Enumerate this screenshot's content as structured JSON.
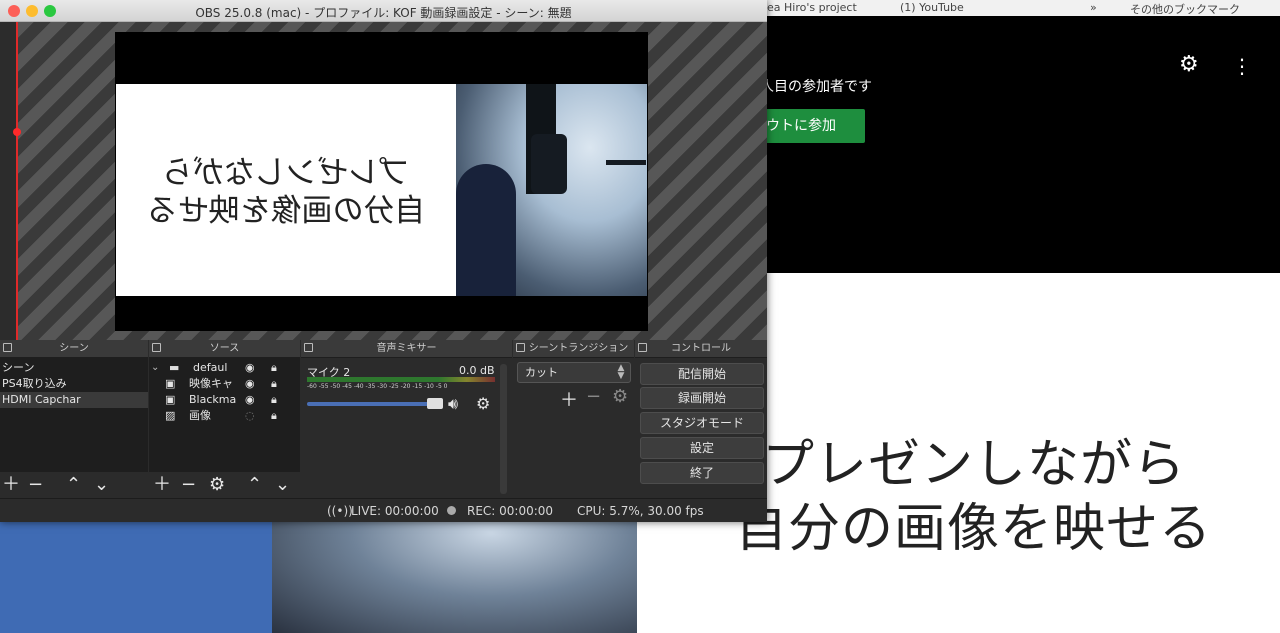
{
  "background": {
    "browser_tabs": [
      "Sea Hiro's project",
      "(1) YouTube",
      "»",
      "その他のブックマーク"
    ],
    "meet_join_text": "人目の参加者です",
    "meet_join_button": "ウトに参加",
    "slide_line1": "プレゼンしながら",
    "slide_line2": "自分の画像を映せる"
  },
  "window": {
    "title": "OBS 25.0.8 (mac) - プロファイル: KOF 動画録画設定 - シーン: 無題"
  },
  "preview": {
    "mirrored_line1": "プレゼンしながら",
    "mirrored_line2": "自分の画像を映せる"
  },
  "docks": {
    "scenes": {
      "title": "シーン",
      "items": [
        "シーン",
        "PS4取り込み",
        "HDMI Capchar"
      ],
      "selected_index": 2
    },
    "sources": {
      "title": "ソース",
      "items": [
        {
          "label": "defaul",
          "icon": "folder-icon"
        },
        {
          "label": "映像キャ",
          "icon": "camera-icon"
        },
        {
          "label": "Blackma",
          "icon": "camera-icon"
        },
        {
          "label": "画像",
          "icon": "image-icon"
        }
      ]
    },
    "mixer": {
      "title": "音声ミキサー",
      "channel": "マイク 2",
      "level": "0.0 dB",
      "ticks": "-60 -55 -50 -45 -40 -35 -30 -25 -20 -15 -10 -5 0",
      "volume_fraction": 0.88
    },
    "transitions": {
      "title": "シーントランジション",
      "selected": "カット"
    },
    "controls": {
      "title": "コントロール",
      "buttons": [
        "配信開始",
        "録画開始",
        "スタジオモード",
        "設定",
        "終了"
      ]
    }
  },
  "status": {
    "live": "LIVE: 00:00:00",
    "rec": "REC: 00:00:00",
    "cpu": "CPU: 5.7%, 30.00 fps"
  },
  "colors": {
    "accent_green": "#1e8e3e",
    "volume_blue": "#4a6fb5",
    "preview_red": "#e02a2a"
  }
}
